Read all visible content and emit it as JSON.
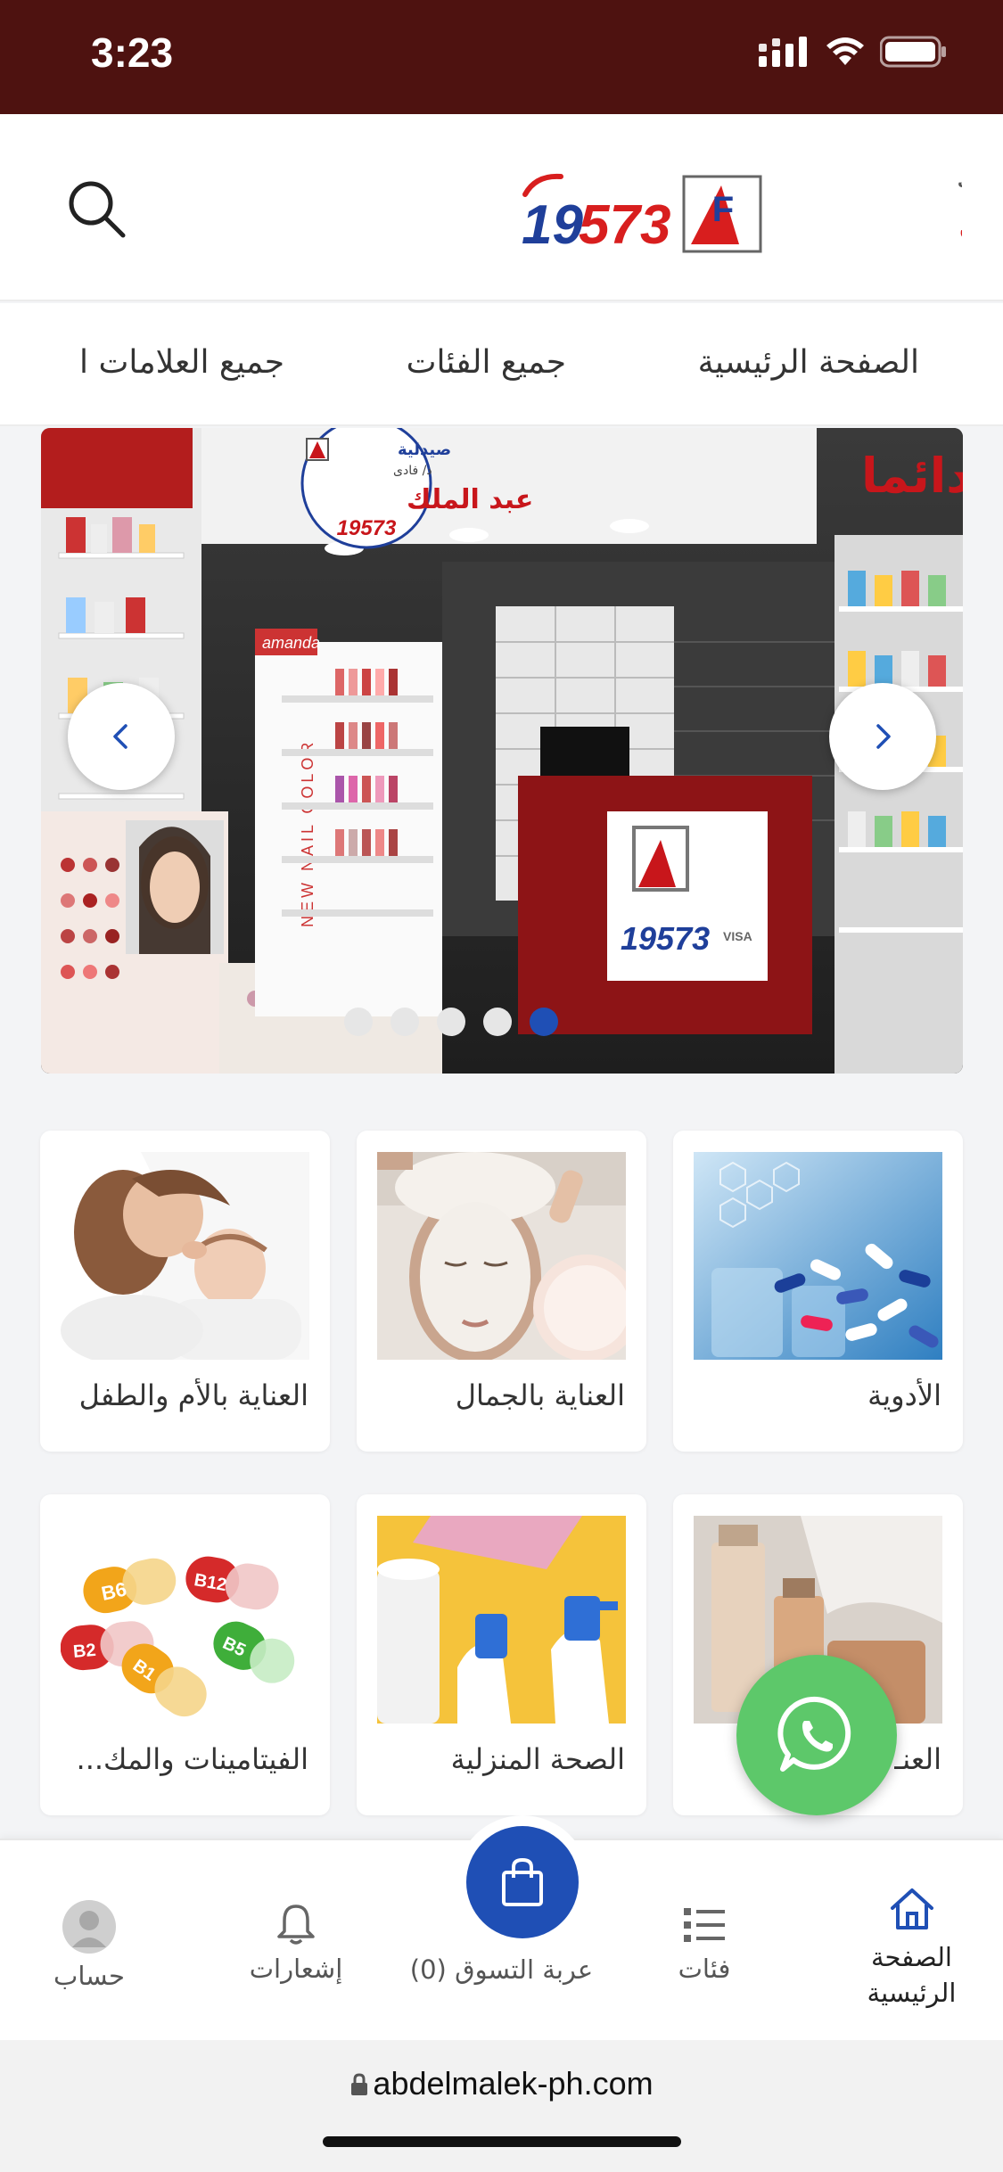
{
  "status_bar": {
    "time": "3:23"
  },
  "header": {
    "logo_text_small": "صيدلية د/فادى",
    "logo_text_main": "عبد الملك",
    "logo_number": "19573"
  },
  "nav": {
    "items": [
      "الصفحة الرئيسية",
      "جميع الفئات",
      "جميع العلامات ا"
    ]
  },
  "carousel": {
    "banner_text": "نسعد بخدمتكم دائما",
    "badge_small": "صيدلية",
    "badge_sub": "د/ فادى",
    "badge_main": "عبد الملك",
    "badge_number": "19573",
    "counter_number": "19573",
    "shelf_brand": "amanda",
    "shelf_side_text": "NEW NAIL COLOR",
    "visa_text": "VISA",
    "active_slide": 5,
    "slide_count": 5
  },
  "categories": [
    {
      "label": "الأدوية",
      "image": "medicine-pills-image"
    },
    {
      "label": "العناية بالجمال",
      "image": "face-mask-image"
    },
    {
      "label": "العناية بالأم والطفل",
      "image": "mother-baby-image"
    },
    {
      "label": "العنـ",
      "image": "cosmetic-bottles-image"
    },
    {
      "label": "الصحة المنزلية",
      "image": "cleaning-supplies-image"
    },
    {
      "label": "الفيتامينات والمك...",
      "image": "vitamin-capsules-image"
    }
  ],
  "vitamin_labels": [
    "B6",
    "B12",
    "B2",
    "B5",
    "B1"
  ],
  "bottom_nav": {
    "home": "الصفحة الرئيسية",
    "categories": "فئات",
    "cart": "عربة التسوق (0)",
    "notifications": "إشعارات",
    "account": "حساب"
  },
  "url_bar": {
    "domain": "abdelmalek-ph.com"
  },
  "colors": {
    "status_bar_bg": "#4e1210",
    "accent_blue": "#1f4fb5",
    "brand_red": "#d81e1e",
    "whatsapp_green": "#5dc86a"
  }
}
